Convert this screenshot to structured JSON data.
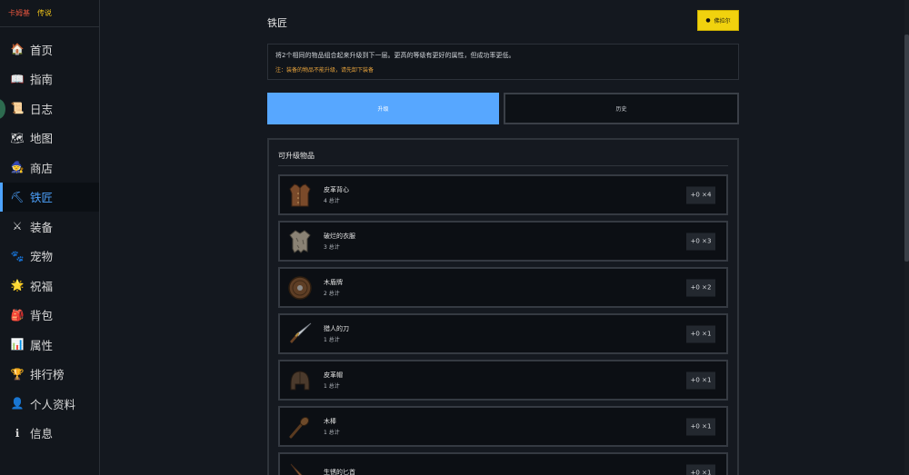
{
  "brand": {
    "name": "卡姆基",
    "tag": "传说"
  },
  "sidebar": {
    "items": [
      {
        "label": "首页",
        "icon": "🏠",
        "name": "home"
      },
      {
        "label": "指南",
        "icon": "📖",
        "name": "guide"
      },
      {
        "label": "日志",
        "icon": "📜",
        "name": "log"
      },
      {
        "label": "地图",
        "icon": "🗺",
        "name": "map"
      },
      {
        "label": "商店",
        "icon": "🧙",
        "name": "shop"
      },
      {
        "label": "铁匠",
        "icon": "⛏",
        "name": "blacksmith",
        "active": true
      },
      {
        "label": "装备",
        "icon": "⚔",
        "name": "equipment"
      },
      {
        "label": "宠物",
        "icon": "🐾",
        "name": "pets"
      },
      {
        "label": "祝福",
        "icon": "🌟",
        "name": "blessing"
      },
      {
        "label": "背包",
        "icon": "🎒",
        "name": "backpack"
      },
      {
        "label": "属性",
        "icon": "📊",
        "name": "stats"
      },
      {
        "label": "排行榜",
        "icon": "🏆",
        "name": "leaderboard"
      },
      {
        "label": "个人资料",
        "icon": "👤",
        "name": "profile"
      },
      {
        "label": "信息",
        "icon": "ℹ",
        "name": "info"
      }
    ]
  },
  "page": {
    "title": "铁匠",
    "coin_button": "佛拉尔",
    "notice_main": "将2个相同的物品组合起来升级到下一层。更高的等级有更好的属性，但成功率更低。",
    "notice_warn": "注：装备的物品不能升级，请先卸下装备",
    "tabs": {
      "upgrade": "升级",
      "history": "历史"
    },
    "panel_title": "可升级物品"
  },
  "items": [
    {
      "name": "皮革背心",
      "count": "4 总计",
      "badge": "+0 ×4",
      "icon": "vest-icon"
    },
    {
      "name": "破烂的衣服",
      "count": "3 总计",
      "badge": "+0 ×3",
      "icon": "ragged-clothes-icon"
    },
    {
      "name": "木盾牌",
      "count": "2 总计",
      "badge": "+0 ×2",
      "icon": "wooden-shield-icon"
    },
    {
      "name": "猎人的刀",
      "count": "1 总计",
      "badge": "+0 ×1",
      "icon": "hunter-knife-icon"
    },
    {
      "name": "皮革帽",
      "count": "1 总计",
      "badge": "+0 ×1",
      "icon": "leather-cap-icon"
    },
    {
      "name": "木棒",
      "count": "1 总计",
      "badge": "+0 ×1",
      "icon": "wooden-club-icon"
    },
    {
      "name": "生锈的匕首",
      "count": "",
      "badge": "+0 ×1",
      "icon": "rusty-dagger-icon"
    }
  ],
  "colors": {
    "accent": "#4da3ff",
    "warn": "#e6a23c",
    "coin": "#f1d20e"
  }
}
